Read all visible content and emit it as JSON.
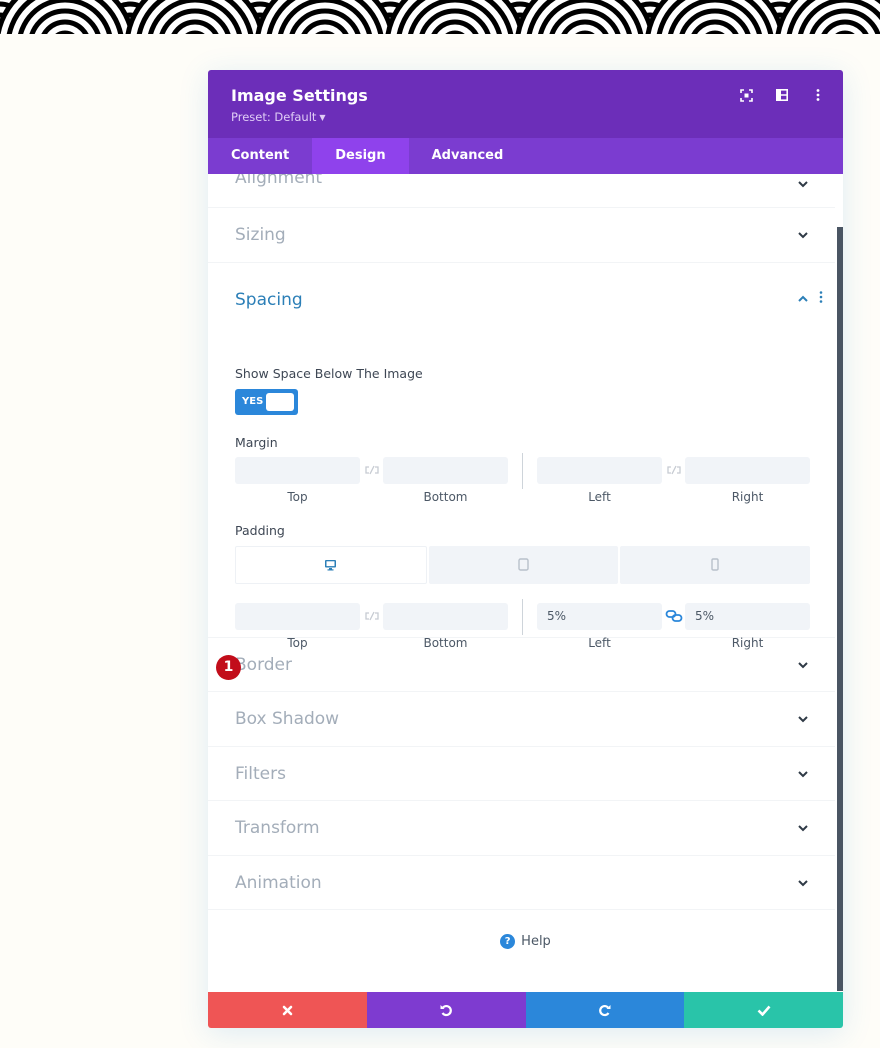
{
  "header": {
    "title": "Image Settings",
    "preset_label": "Preset: Default",
    "icons": [
      "focus-mode-icon",
      "split-view-icon",
      "more-options-icon"
    ]
  },
  "tabs": [
    {
      "label": "Content",
      "active": false
    },
    {
      "label": "Design",
      "active": true
    },
    {
      "label": "Advanced",
      "active": false
    }
  ],
  "sections": {
    "alignment": "Alignment",
    "sizing": "Sizing",
    "spacing": "Spacing",
    "border": "Border",
    "box_shadow": "Box Shadow",
    "filters": "Filters",
    "transform": "Transform",
    "animation": "Animation"
  },
  "spacing": {
    "show_space_label": "Show Space Below The Image",
    "toggle_value": "YES",
    "margin": {
      "label": "Margin",
      "top": "",
      "bottom": "",
      "left": "",
      "right": "",
      "labels": {
        "top": "Top",
        "bottom": "Bottom",
        "left": "Left",
        "right": "Right"
      }
    },
    "padding": {
      "label": "Padding",
      "devices": [
        "desktop",
        "tablet",
        "phone"
      ],
      "active_device": "desktop",
      "top": "",
      "bottom": "",
      "left": "5%",
      "right": "5%",
      "left_right_linked": true,
      "labels": {
        "top": "Top",
        "bottom": "Bottom",
        "left": "Left",
        "right": "Right"
      }
    },
    "step_badge": "1"
  },
  "help_label": "Help",
  "footer": {
    "buttons": [
      {
        "name": "discard",
        "color": "#ef5555"
      },
      {
        "name": "undo",
        "color": "#7e3bd0"
      },
      {
        "name": "redo",
        "color": "#2b87da"
      },
      {
        "name": "save",
        "color": "#29c4a9"
      }
    ]
  },
  "colors": {
    "header": "#6c2eb9",
    "tabs": "#7b3cd0",
    "active_tab": "#8f42ec",
    "accent": "#2b87da",
    "badge": "#c20d1a"
  }
}
